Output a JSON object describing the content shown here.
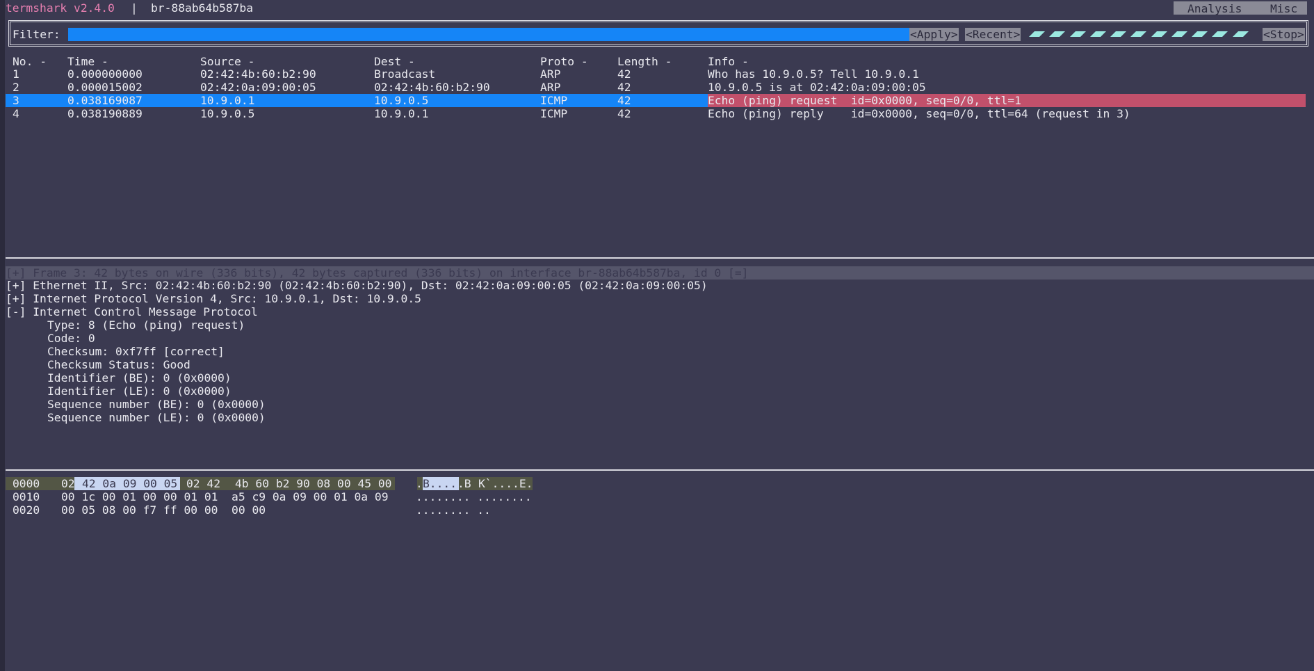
{
  "title": {
    "app": "termshark v2.4.0",
    "sep": "|",
    "interface": "br-88ab64b587ba"
  },
  "menu": {
    "analysis": "Analysis",
    "misc": "Misc"
  },
  "filter": {
    "label": "Filter:",
    "value": "",
    "apply": "<Apply>",
    "recent": "<Recent>",
    "stop": "<Stop>"
  },
  "packet_list": {
    "headers": {
      "no": "No. -",
      "time": "Time -",
      "source": "Source -",
      "dest": "Dest -",
      "proto": "Proto -",
      "length": "Length -",
      "info": "Info -"
    },
    "rows": [
      {
        "no": "1",
        "time": "0.000000000",
        "source": "02:42:4b:60:b2:90",
        "dest": "Broadcast",
        "proto": "ARP",
        "length": "42",
        "info": "Who has 10.9.0.5? Tell 10.9.0.1"
      },
      {
        "no": "2",
        "time": "0.000015002",
        "source": "02:42:0a:09:00:05",
        "dest": "02:42:4b:60:b2:90",
        "proto": "ARP",
        "length": "42",
        "info": "10.9.0.5 is at 02:42:0a:09:00:05"
      },
      {
        "no": "3",
        "time": "0.038169087",
        "source": "10.9.0.1",
        "dest": "10.9.0.5",
        "proto": "ICMP",
        "length": "42",
        "info": "Echo (ping) request  id=0x0000, seq=0/0, ttl=1"
      },
      {
        "no": "4",
        "time": "0.038190889",
        "source": "10.9.0.5",
        "dest": "10.9.0.1",
        "proto": "ICMP",
        "length": "42",
        "info": "Echo (ping) reply    id=0x0000, seq=0/0, ttl=64 (request in 3)"
      }
    ]
  },
  "details": {
    "frame": "[+] Frame 3: 42 bytes on wire (336 bits), 42 bytes captured (336 bits) on interface br-88ab64b587ba, id 0 [=]",
    "ethernet": "[+] Ethernet II, Src: 02:42:4b:60:b2:90 (02:42:4b:60:b2:90), Dst: 02:42:0a:09:00:05 (02:42:0a:09:00:05)",
    "ip": "[+] Internet Protocol Version 4, Src: 10.9.0.1, Dst: 10.9.0.5",
    "icmp": "[-] Internet Control Message Protocol",
    "icmp_fields": [
      "Type: 8 (Echo (ping) request)",
      "Code: 0",
      "Checksum: 0xf7ff [correct]",
      "Checksum Status: Good",
      "Identifier (BE): 0 (0x0000)",
      "Identifier (LE): 0 (0x0000)",
      "Sequence number (BE): 0 (0x0000)",
      "Sequence number (LE): 0 (0x0000)"
    ]
  },
  "hex": {
    "rows": [
      {
        "offset": "0000",
        "b0": "02",
        "sel": "42 0a 09 00 05",
        "b6": "02 42",
        "b8": "4b 60 b2 90 08 00 45 00",
        "a0": ".",
        "asel": "B....",
        "a6": ".B",
        "a8": "K`....E."
      },
      {
        "offset": "0010",
        "bytes": "00 1c 00 01 00 00 01 01  a5 c9 0a 09 00 01 0a 09",
        "ascii": "........ ........"
      },
      {
        "offset": "0020",
        "bytes": "00 05 08 00 f7 ff 00 00  00 00",
        "ascii": "........ .."
      }
    ]
  },
  "colors": {
    "background": "#3b3a51",
    "title_accent": "#e67fb0",
    "selection": "#1585f7",
    "info_highlight": "#c2506b",
    "button": "#8a8a96",
    "loading": "#9be8e0"
  }
}
